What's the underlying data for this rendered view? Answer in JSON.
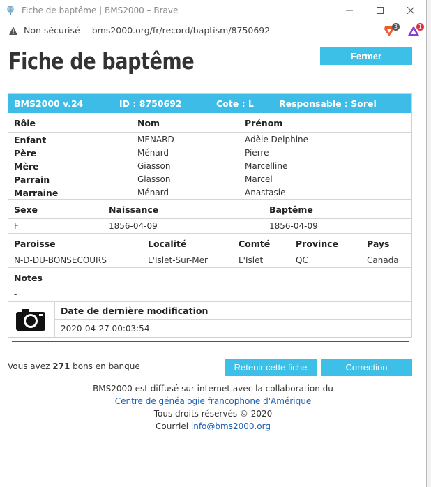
{
  "window": {
    "title": "Fiche de baptême | BMS2000 – Brave"
  },
  "address": {
    "security": "Non sécurisé",
    "url": "bms2000.org/fr/record/baptism/8750692",
    "ext_badge_1": "3",
    "ext_badge_2": "1"
  },
  "page": {
    "title": "Fiche de baptême",
    "close_label": "Fermer"
  },
  "record_header": {
    "version": "BMS2000 v.24",
    "id": "ID : 8750692",
    "cote": "Cote : L",
    "responsable": "Responsable : Sorel"
  },
  "people": {
    "headers": [
      "Rôle",
      "Nom",
      "Prénom"
    ],
    "rows": [
      [
        "Enfant",
        "MENARD",
        "Adèle Delphine"
      ],
      [
        "Père",
        "Ménard",
        "Pierre"
      ],
      [
        "Mère",
        "Giasson",
        "Marcelline"
      ],
      [
        "Parrain",
        "Giasson",
        "Marcel"
      ],
      [
        "Marraine",
        "Ménard",
        "Anastasie"
      ]
    ]
  },
  "dates": {
    "headers": [
      "Sexe",
      "Naissance",
      "Baptême"
    ],
    "values": [
      "F",
      "1856-04-09",
      "1856-04-09"
    ]
  },
  "place": {
    "headers": [
      "Paroisse",
      "Localité",
      "Comté",
      "Province",
      "Pays"
    ],
    "values": [
      "N-D-DU-BONSECOURS",
      "L'Islet-Sur-Mer",
      "L'Islet",
      "QC",
      "Canada"
    ]
  },
  "notes": {
    "header": "Notes",
    "value": "-"
  },
  "modification": {
    "header": "Date de dernière modification",
    "value": "2020-04-27 00:03:54"
  },
  "bank": {
    "prefix": "Vous avez",
    "count": "271",
    "suffix": "bons en banque"
  },
  "actions": {
    "keep_label": "Retenir cette fiche",
    "correction_label": "Correction"
  },
  "footer": {
    "line1": "BMS2000 est diffusé sur internet avec la collaboration du",
    "link1": "Centre de généalogie francophone d'Amérique",
    "line3": "Tous droits réservés © 2020",
    "line4_prefix": "Courriel",
    "email": "info@bms2000.org"
  },
  "colors": {
    "accent": "#3cbce6",
    "link": "#1a5fb4"
  }
}
